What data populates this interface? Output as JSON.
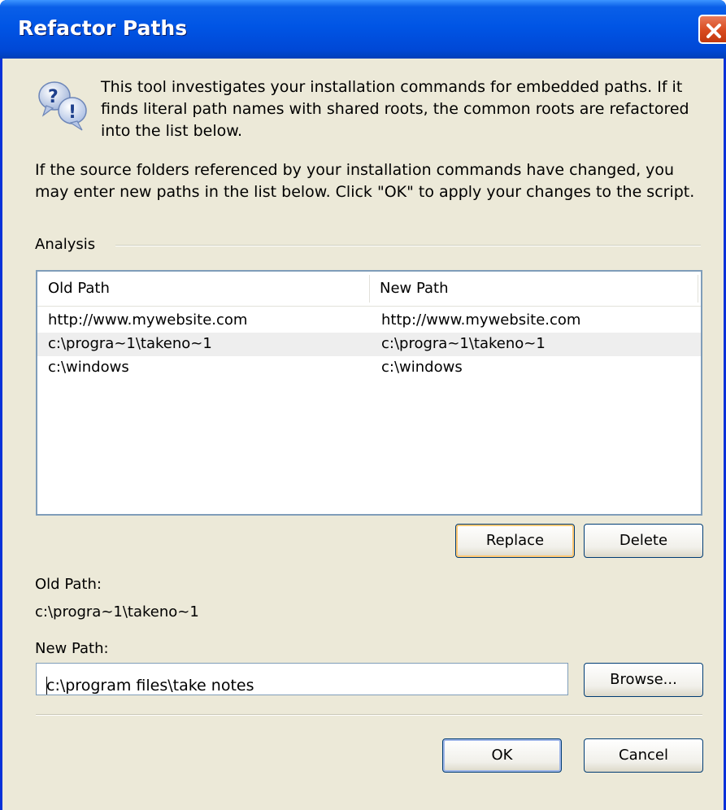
{
  "window": {
    "title": "Refactor Paths",
    "close_icon": "close-icon"
  },
  "intro_text": "This tool investigates your installation commands for embedded paths. If it finds literal path names with shared roots, the common roots are refactored into the list below.",
  "instructions_text": "If the source folders referenced by your installation commands have changed, you may enter new paths in the list below. Click \"OK\" to apply your changes to the script.",
  "analysis": {
    "label": "Analysis",
    "columns": [
      "Old Path",
      "New Path"
    ],
    "rows": [
      {
        "old": "http://www.mywebsite.com",
        "new": "http://www.mywebsite.com",
        "selected": false
      },
      {
        "old": "c:\\progra~1\\takeno~1",
        "new": "c:\\progra~1\\takeno~1",
        "selected": true
      },
      {
        "old": "c:\\windows",
        "new": "c:\\windows",
        "selected": false
      }
    ]
  },
  "buttons": {
    "replace": "Replace",
    "delete": "Delete",
    "browse": "Browse...",
    "ok": "OK",
    "cancel": "Cancel"
  },
  "old_path": {
    "label": "Old Path:",
    "value": "c:\\progra~1\\takeno~1"
  },
  "new_path": {
    "label": "New Path:",
    "value": "c:\\program files\\take notes"
  },
  "colors": {
    "title_bar": "#0055e5",
    "dialog_bg": "#ece9d8",
    "selection": "#eeeeee"
  }
}
